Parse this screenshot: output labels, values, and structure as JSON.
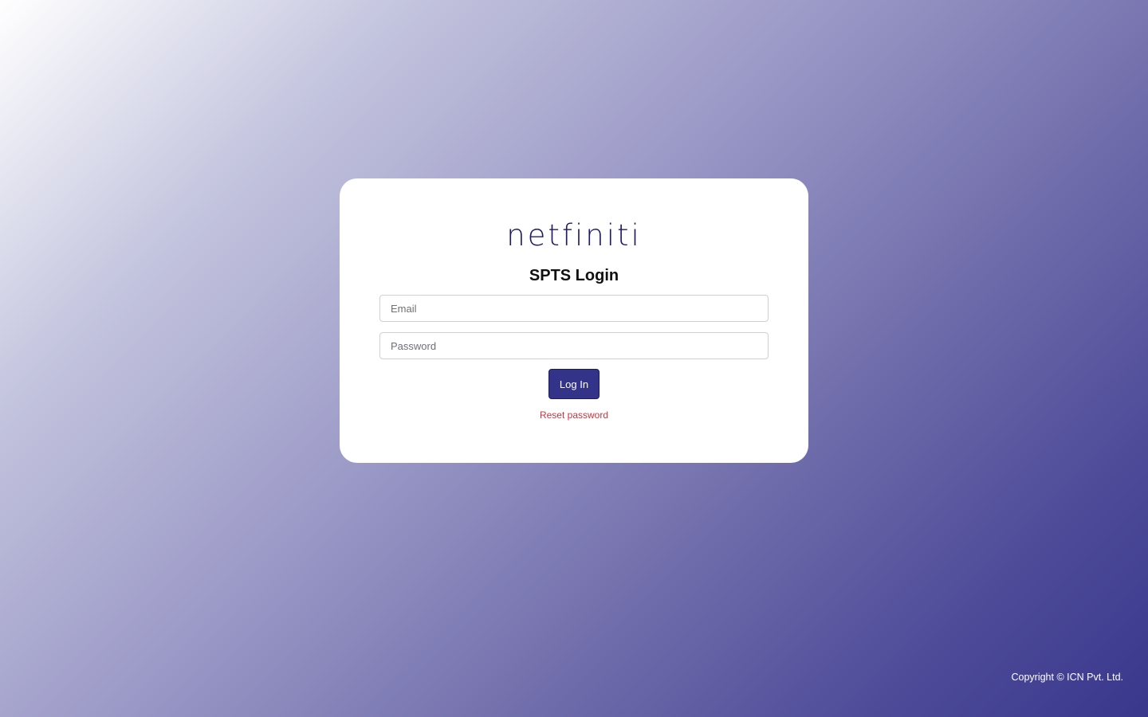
{
  "brand": {
    "logo_text": "netfiniti"
  },
  "login": {
    "title": "SPTS Login",
    "email_placeholder": "Email",
    "email_value": "",
    "password_placeholder": "Password",
    "password_value": "",
    "login_button_label": "Log In",
    "reset_password_label": "Reset password"
  },
  "footer": {
    "copyright": "Copyright © ICN Pvt. Ltd."
  },
  "colors": {
    "accent": "#34338a",
    "logo": "#1f1b63",
    "reset_link": "#c8343e",
    "background_end": "#39378c"
  }
}
